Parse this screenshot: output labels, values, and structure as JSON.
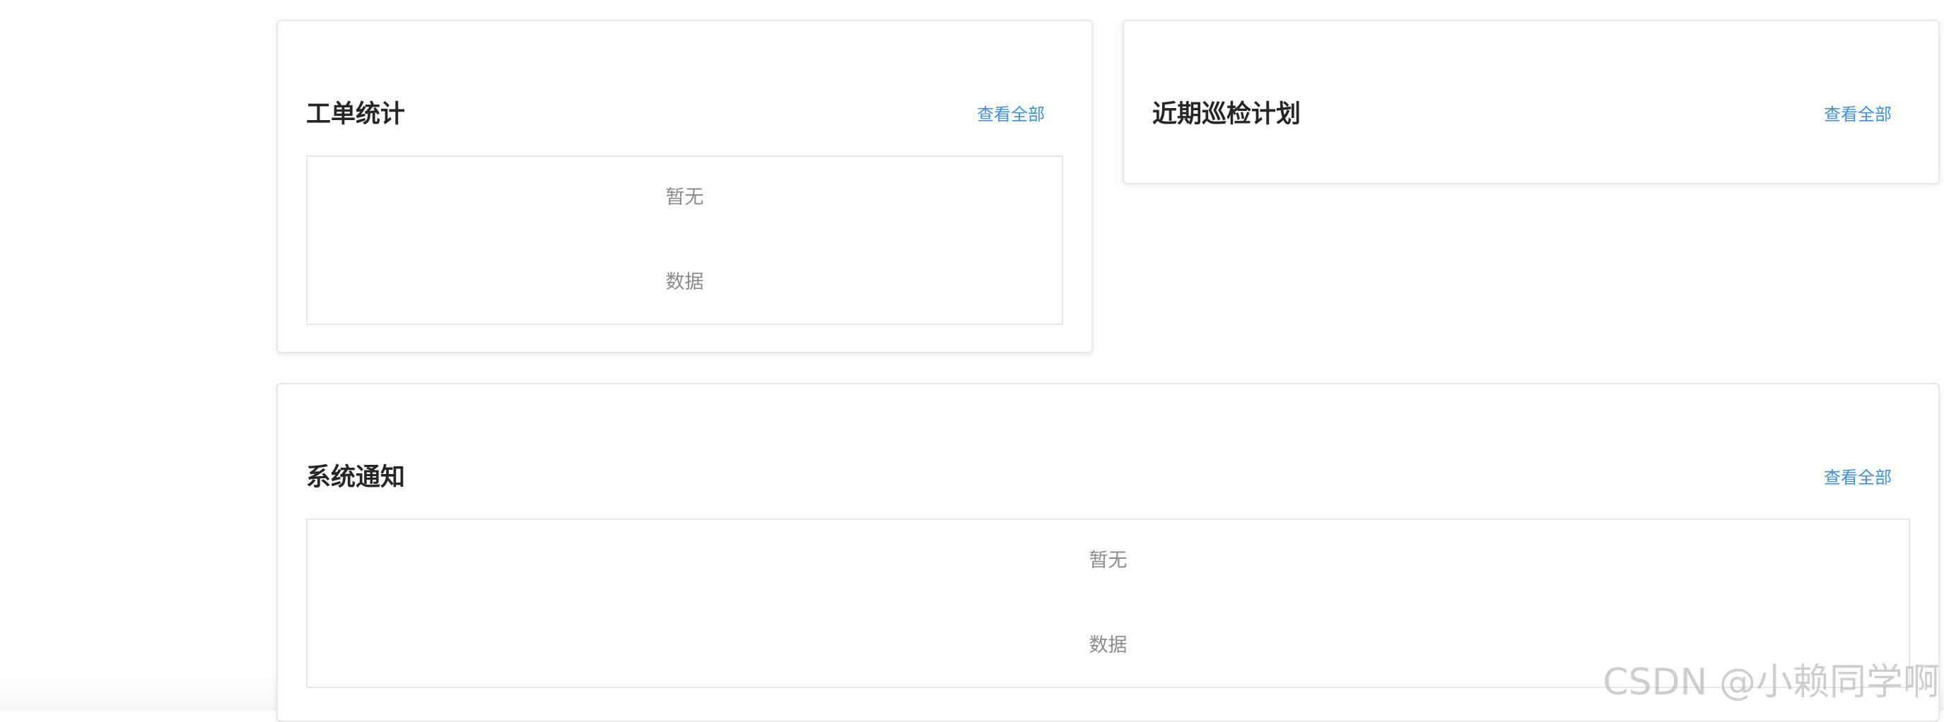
{
  "cards": {
    "work_orders": {
      "title": "工单统计",
      "view_all_label": "查看全部",
      "empty_line1": "暂无",
      "empty_line2": "数据"
    },
    "inspection_plans": {
      "title": "近期巡检计划",
      "view_all_label": "查看全部"
    },
    "system_notices": {
      "title": "系统通知",
      "view_all_label": "查看全部",
      "empty_line1": "暂无",
      "empty_line2": "数据"
    }
  },
  "watermark": "CSDN @小赖同学啊",
  "colors": {
    "link": "#3d8fe6",
    "title": "#262626",
    "empty_text": "#8c8c8c",
    "border": "#e8e8e8"
  }
}
